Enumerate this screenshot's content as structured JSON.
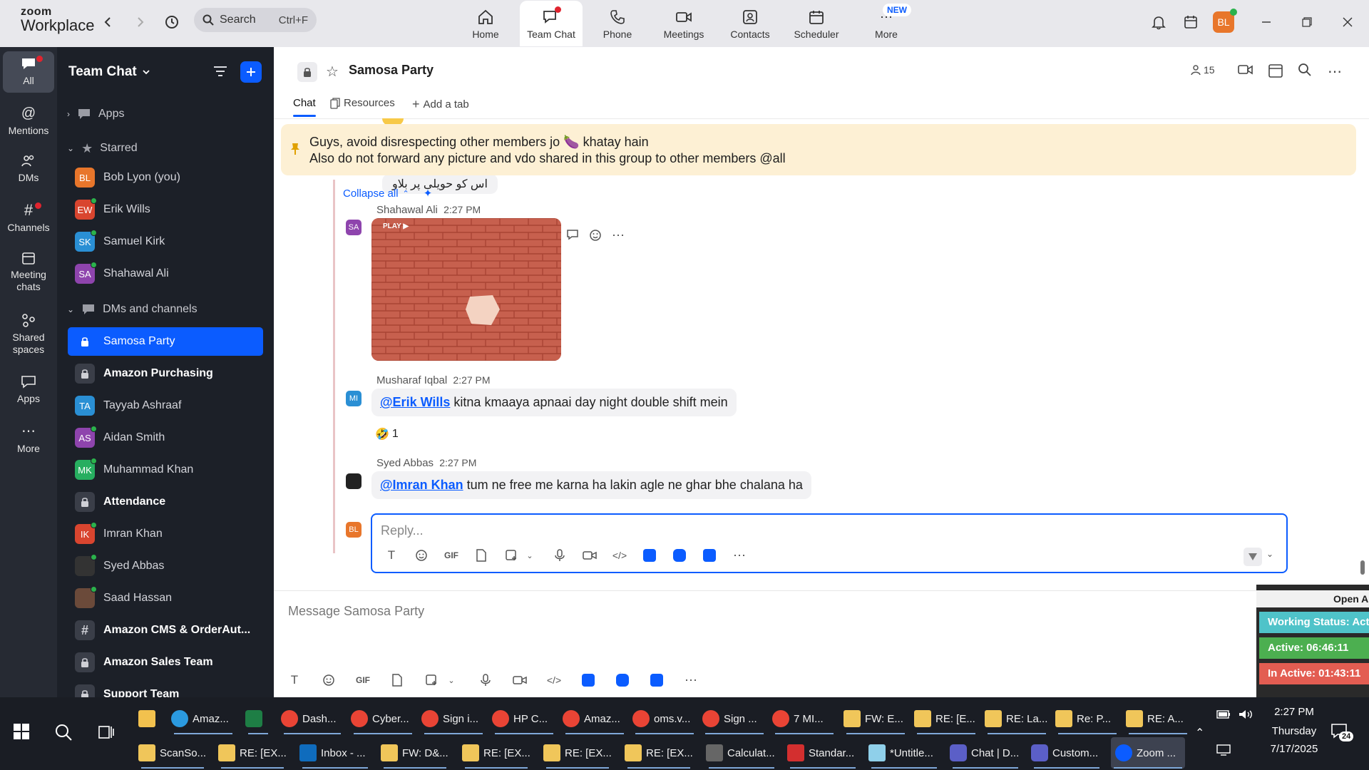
{
  "app": {
    "logo_line1": "zoom",
    "logo_line2": "Workplace"
  },
  "search": {
    "label": "Search",
    "shortcut": "Ctrl+F"
  },
  "nav_tabs": [
    {
      "label": "Home"
    },
    {
      "label": "Team Chat"
    },
    {
      "label": "Phone"
    },
    {
      "label": "Meetings"
    },
    {
      "label": "Contacts"
    },
    {
      "label": "Scheduler"
    },
    {
      "label": "More"
    }
  ],
  "new_badge": "NEW",
  "profile_initials": "BL",
  "rail": [
    {
      "label": "All"
    },
    {
      "label": "Mentions"
    },
    {
      "label": "DMs"
    },
    {
      "label": "Channels"
    },
    {
      "label": "Meeting chats"
    },
    {
      "label": "Shared spaces"
    },
    {
      "label": "Apps"
    },
    {
      "label": "More"
    }
  ],
  "sidebar": {
    "title": "Team Chat",
    "sections": {
      "apps": "Apps",
      "starred": "Starred",
      "dms": "DMs and channels"
    },
    "starred": [
      {
        "initials": "BL",
        "name": "Bob Lyon (you)",
        "color": "#e8762b"
      },
      {
        "initials": "EW",
        "name": "Erik Wills",
        "color": "#d9452f"
      },
      {
        "initials": "SK",
        "name": "Samuel Kirk",
        "color": "#2a8fd4"
      },
      {
        "initials": "SA",
        "name": "Shahawal Ali",
        "color": "#8e44ad"
      }
    ],
    "channels": [
      {
        "name": "Samosa Party",
        "type": "lock",
        "active": true
      },
      {
        "name": "Amazon Purchasing",
        "type": "lock",
        "bold": true
      },
      {
        "initials": "TA",
        "name": "Tayyab Ashraaf",
        "color": "#2a8fd4"
      },
      {
        "initials": "AS",
        "name": "Aidan Smith",
        "color": "#8e44ad"
      },
      {
        "initials": "MK",
        "name": "Muhammad Khan",
        "color": "#27ae60"
      },
      {
        "name": "Attendance",
        "type": "lock",
        "bold": true
      },
      {
        "initials": "IK",
        "name": "Imran Khan",
        "color": "#d9452f"
      },
      {
        "initials": "",
        "name": "Syed Abbas",
        "color": "#333333"
      },
      {
        "initials": "",
        "name": "Saad Hassan",
        "color": "#6b4a3a"
      },
      {
        "name": "Amazon CMS & OrderAut...",
        "type": "hash",
        "bold": true
      },
      {
        "name": "Amazon Sales Team",
        "type": "lock",
        "bold": true
      },
      {
        "name": "Support Team",
        "type": "lock",
        "bold": true
      }
    ]
  },
  "channel": {
    "title": "Samosa Party",
    "member_count": "15",
    "tabs": {
      "chat": "Chat",
      "resources": "Resources",
      "add": "Add a tab"
    }
  },
  "pinned": {
    "line1": "Guys, avoid disrespecting other members jo 🍆 khatay hain",
    "line2": "Also do not forward any picture and vdo shared in this group to other members @all"
  },
  "thread": {
    "prev_text": "اس کو حویلی پر بلاو",
    "collapse": "Collapse all",
    "messages": [
      {
        "initials": "SA",
        "sender": "Shahawal Ali",
        "time": "2:27 PM",
        "image_label": "PLAY ▶"
      },
      {
        "initials": "MI",
        "sender": "Musharaf Iqbal",
        "time": "2:27 PM",
        "mention": "@Erik Wills",
        "text": " kitna kmaaya apnaai day night double shift mein",
        "reaction_emoji": "🤣",
        "reaction_count": "1"
      },
      {
        "sender": "Syed Abbas",
        "time": "2:27 PM",
        "mention": "@Imran Khan",
        "text": " tum ne free me karna ha lakin agle ne ghar bhe chalana ha"
      }
    ],
    "reply_initials": "BL",
    "reply_placeholder": "Reply...",
    "gif_label": "GIF"
  },
  "composer": {
    "placeholder": "Message Samosa Party",
    "gif_label": "GIF"
  },
  "widget": {
    "open": "Open A",
    "working": "Working Status: Acti",
    "active": "Active: 06:46:11",
    "inactive": "In Active: 01:43:11"
  },
  "taskbar": {
    "row1": [
      "",
      "Amaz...",
      "",
      "Dash...",
      "Cyber...",
      "Sign i...",
      "HP C...",
      "Amaz...",
      "oms.v...",
      "Sign ...",
      "7 MI...",
      "FW: E...",
      "RE: [E...",
      "RE: La...",
      "Re: P...",
      "RE: A..."
    ],
    "row2": [
      "ScanSo...",
      "RE: [EX...",
      "Inbox - ...",
      "FW: D&...",
      "RE: [EX...",
      "RE: [EX...",
      "RE: [EX...",
      "Calculat...",
      "Standar...",
      "*Untitle...",
      "Chat | D...",
      "Custom...",
      "Zoom ..."
    ],
    "time": "2:27 PM",
    "day": "Thursday",
    "date": "7/17/2025",
    "notif_count": "24"
  },
  "colors": {
    "accent": "#0b5cff",
    "sidebar": "#1c2028",
    "rail": "#262a33",
    "pinned_bg": "#fdf0d4",
    "green": "#2bb24c"
  }
}
